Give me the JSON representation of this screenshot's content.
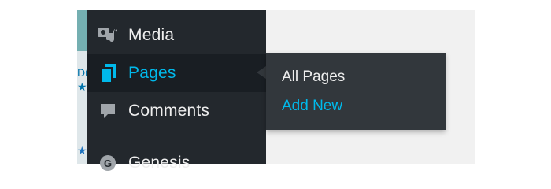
{
  "left_strip": {
    "text_line1": "Di",
    "text_line2": "★",
    "bottom_star": "★"
  },
  "admin_menu": {
    "items": [
      {
        "id": "media",
        "label": "Media",
        "icon": "media-icon"
      },
      {
        "id": "pages",
        "label": "Pages",
        "icon": "pages-icon",
        "current": true
      },
      {
        "id": "comments",
        "label": "Comments",
        "icon": "comments-icon"
      },
      {
        "id": "genesis",
        "label": "Genesis",
        "icon": "genesis-icon",
        "icon_letter": "G"
      }
    ]
  },
  "flyout": {
    "items": [
      {
        "label": "All Pages"
      },
      {
        "label": "Add New"
      }
    ]
  },
  "colors": {
    "menu_bg": "#23282d",
    "menu_current_bg": "#191e23",
    "flyout_bg": "#32373c",
    "accent": "#00b9eb",
    "text": "#eeeeee",
    "icon": "#a0a5aa"
  }
}
